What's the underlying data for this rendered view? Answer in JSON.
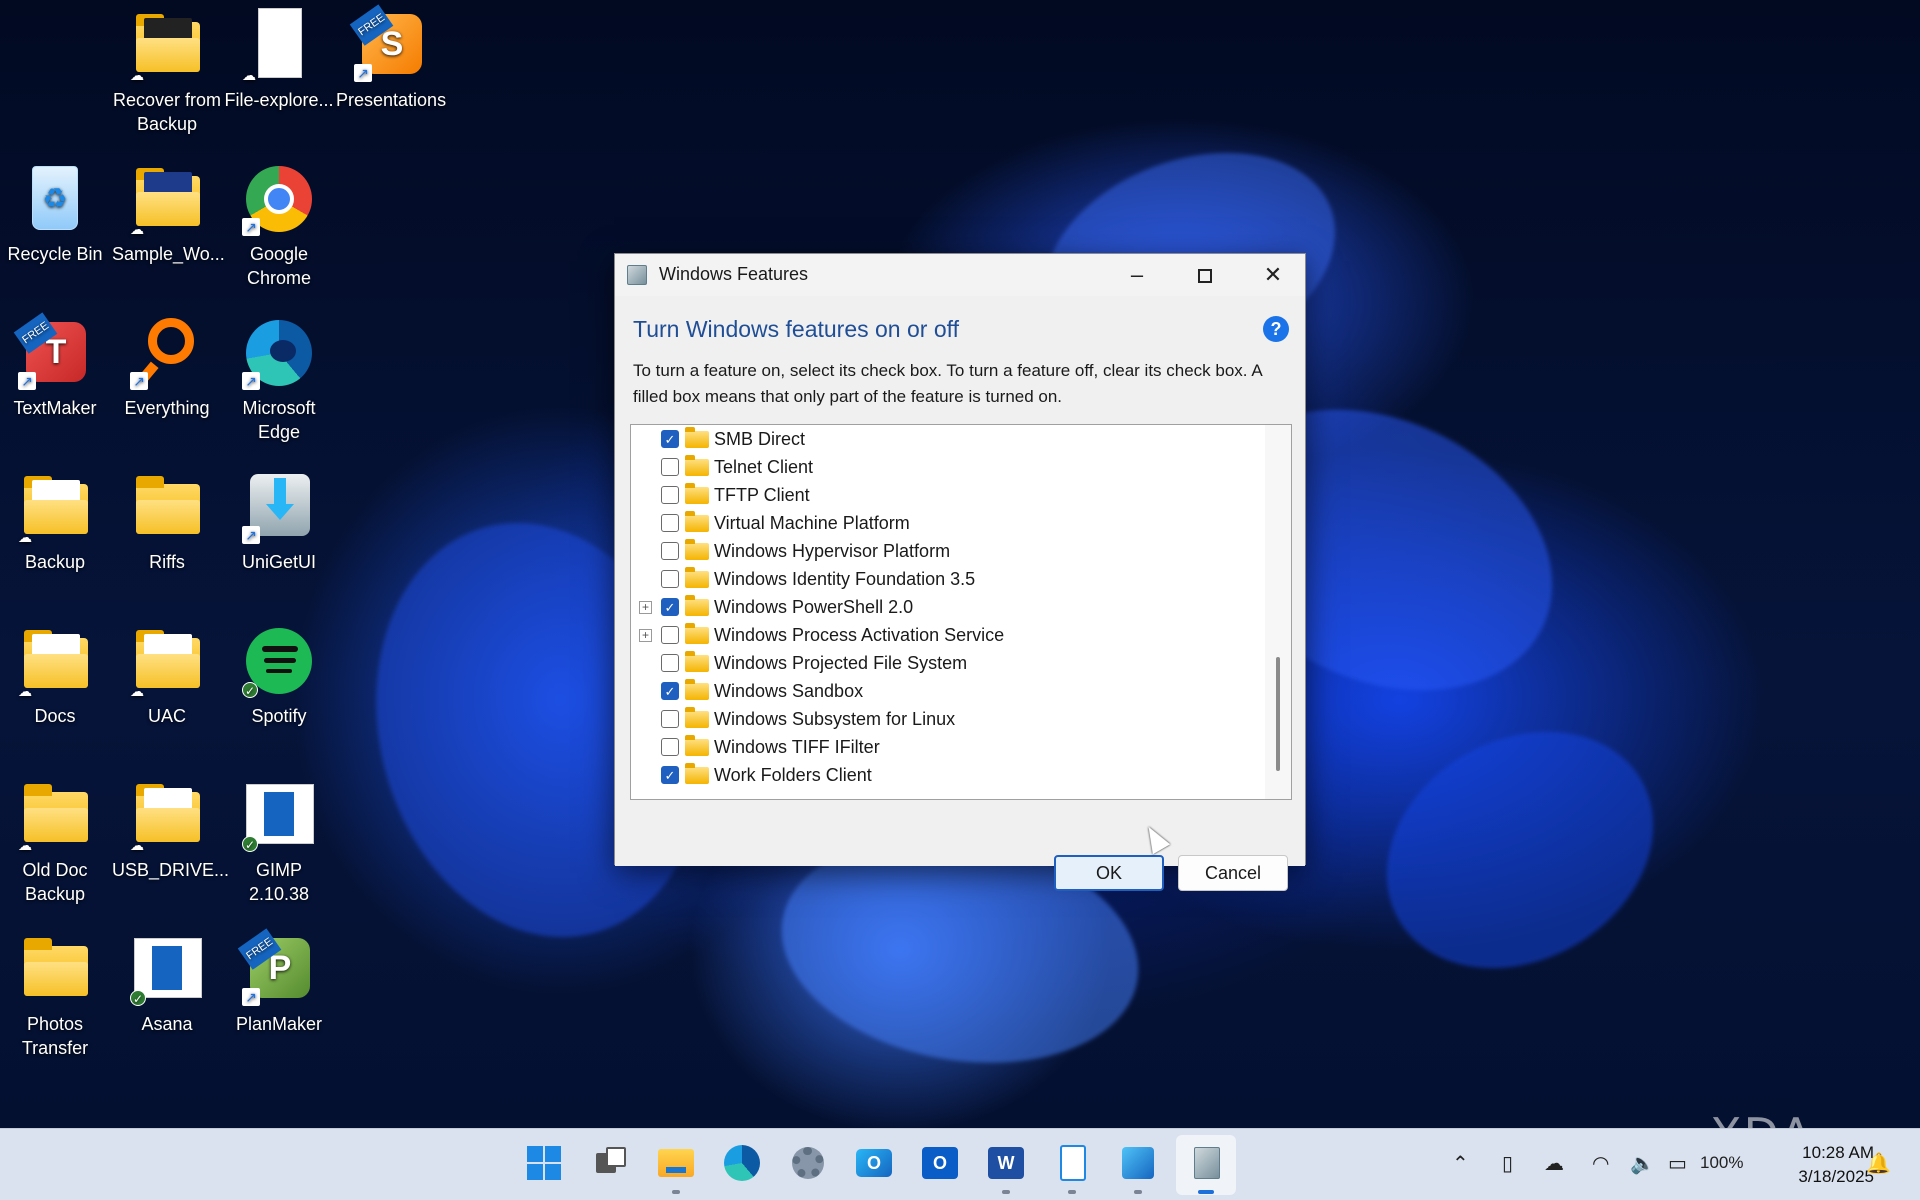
{
  "desktop": {
    "icons": [
      {
        "label": "Recover from Backup",
        "type": "folder"
      },
      {
        "label": "File-explore...",
        "type": "document"
      },
      {
        "label": "Presentations",
        "type": "app"
      },
      {
        "label": "Recycle Bin",
        "type": "recycle"
      },
      {
        "label": "Sample_Wo...",
        "type": "folder"
      },
      {
        "label": "Google Chrome",
        "type": "app"
      },
      {
        "label": "TextMaker",
        "type": "app"
      },
      {
        "label": "Everything",
        "type": "app"
      },
      {
        "label": "Microsoft Edge",
        "type": "app"
      },
      {
        "label": "Backup",
        "type": "folder"
      },
      {
        "label": "Riffs",
        "type": "folder"
      },
      {
        "label": "UniGetUI",
        "type": "app"
      },
      {
        "label": "Docs",
        "type": "folder"
      },
      {
        "label": "UAC",
        "type": "folder"
      },
      {
        "label": "Spotify",
        "type": "app"
      },
      {
        "label": "Old Doc Backup",
        "type": "folder"
      },
      {
        "label": "USB_DRIVE...",
        "type": "folder"
      },
      {
        "label": "GIMP 2.10.38",
        "type": "app"
      },
      {
        "label": "Photos Transfer",
        "type": "folder"
      },
      {
        "label": "Asana",
        "type": "app"
      },
      {
        "label": "PlanMaker",
        "type": "app"
      }
    ],
    "badges": {
      "free": "FREE",
      "presentations_letter": "S",
      "textmaker_letter": "T",
      "planmaker_letter": "P"
    }
  },
  "dialog": {
    "title": "Windows Features",
    "heading": "Turn Windows features on or off",
    "help_symbol": "?",
    "description": "To turn a feature on, select its check box. To turn a feature off, clear its check box. A filled box means that only part of the feature is turned on.",
    "features": [
      {
        "label": "SMB Direct",
        "checked": true,
        "expandable": false
      },
      {
        "label": "Telnet Client",
        "checked": false,
        "expandable": false
      },
      {
        "label": "TFTP Client",
        "checked": false,
        "expandable": false
      },
      {
        "label": "Virtual Machine Platform",
        "checked": false,
        "expandable": false
      },
      {
        "label": "Windows Hypervisor Platform",
        "checked": false,
        "expandable": false
      },
      {
        "label": "Windows Identity Foundation 3.5",
        "checked": false,
        "expandable": false
      },
      {
        "label": "Windows PowerShell 2.0",
        "checked": true,
        "expandable": true
      },
      {
        "label": "Windows Process Activation Service",
        "checked": false,
        "expandable": true
      },
      {
        "label": "Windows Projected File System",
        "checked": false,
        "expandable": false
      },
      {
        "label": "Windows Sandbox",
        "checked": true,
        "expandable": false
      },
      {
        "label": "Windows Subsystem for Linux",
        "checked": false,
        "expandable": false
      },
      {
        "label": "Windows TIFF IFilter",
        "checked": false,
        "expandable": false
      },
      {
        "label": "Work Folders Client",
        "checked": true,
        "expandable": false
      }
    ],
    "ok_label": "OK",
    "cancel_label": "Cancel"
  },
  "taskbar": {
    "apps": [
      "start",
      "task-view",
      "file-explorer",
      "edge",
      "settings",
      "outlook-new",
      "outlook",
      "word",
      "notepad",
      "photos",
      "windows-features"
    ],
    "tray": {
      "battery": "100%",
      "time": "10:28 AM",
      "date": "3/18/2025"
    }
  },
  "watermark": "XDA",
  "colors": {
    "accent": "#1f5fbf",
    "heading": "#1f4e96",
    "taskbar": "#d9e2ee"
  }
}
